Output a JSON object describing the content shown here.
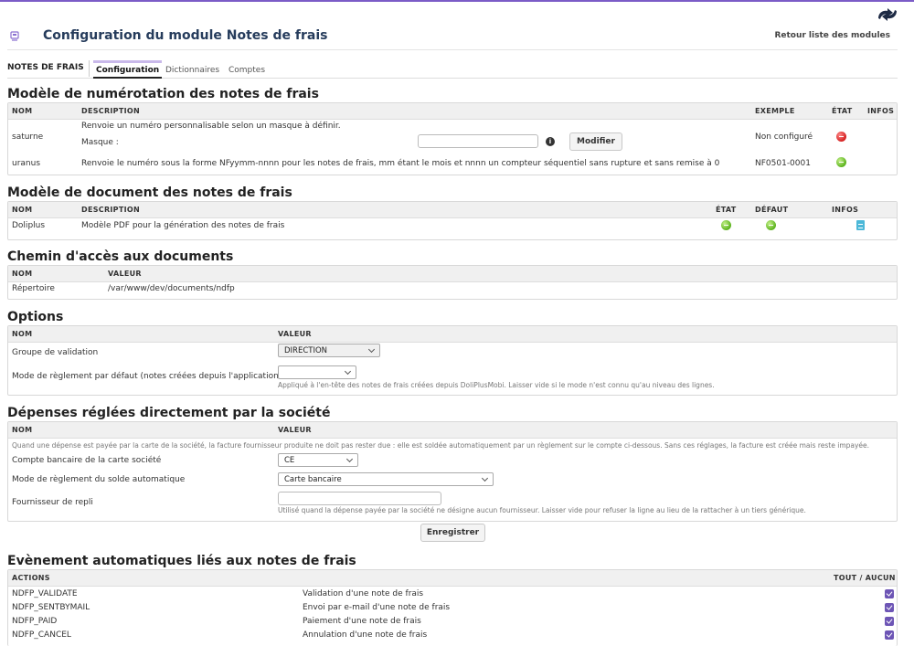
{
  "header": {
    "title": "Configuration du module Notes de frais",
    "back_link": "Retour liste des modules"
  },
  "tabs": {
    "module": "NOTES DE FRAIS",
    "items": [
      {
        "label": "Configuration"
      },
      {
        "label": "Dictionnaires"
      },
      {
        "label": "Comptes"
      }
    ]
  },
  "numbering": {
    "title": "Modèle de numérotation des notes de frais",
    "columns": {
      "name": "NOM",
      "description": "DESCRIPTION",
      "example": "EXEMPLE",
      "state": "ÉTAT",
      "infos": "INFOS"
    },
    "rows": [
      {
        "name": "saturne",
        "description": "Renvoie un numéro personnalisable selon un masque à définir.",
        "mask_label": "Masque :",
        "mask_value": "",
        "modify_label": "Modifier",
        "example": "Non configuré",
        "state": "disabled"
      },
      {
        "name": "uranus",
        "description": "Renvoie le numéro sous la forme NFyymm-nnnn pour les notes de frais, mm étant le mois et nnnn un compteur séquentiel sans rupture et sans remise à 0",
        "example": "NF0501-0001",
        "state": "enabled"
      }
    ]
  },
  "documents": {
    "title": "Modèle de document des notes de frais",
    "columns": {
      "name": "NOM",
      "description": "DESCRIPTION",
      "state": "ÉTAT",
      "default": "DÉFAUT",
      "infos": "INFOS"
    },
    "rows": [
      {
        "name": "Doliplus",
        "description": "Modèle PDF pour la génération des notes de frais",
        "state": "enabled",
        "default": "enabled",
        "info_icon": "document-icon"
      }
    ]
  },
  "path": {
    "title": "Chemin d'accès aux documents",
    "columns": {
      "name": "NOM",
      "value": "VALEUR"
    },
    "rows": [
      {
        "name": "Répertoire",
        "value": "/var/www/dev/documents/ndfp"
      }
    ]
  },
  "options": {
    "title": "Options",
    "columns": {
      "name": "NOM",
      "value": "VALEUR"
    },
    "validation_group_label": "Groupe de validation",
    "validation_group_value": "DIRECTION",
    "payment_mode_label": "Mode de règlement par défaut (notes créées depuis l'application)",
    "payment_mode_value": "",
    "payment_mode_note": "Appliqué à l'en-tête des notes de frais créées depuis DoliPlusMobi. Laisser vide si le mode n'est connu qu'au niveau des lignes."
  },
  "company_expenses": {
    "title": "Dépenses réglées directement par la société",
    "columns": {
      "name": "NOM",
      "value": "VALEUR"
    },
    "intro": "Quand une dépense est payée par la carte de la société, la facture fournisseur produite ne doit pas rester due : elle est soldée automatiquement par un règlement sur le compte ci-dessous. Sans ces réglages, la facture est créée mais reste impayée.",
    "bank_account_label": "Compte bancaire de la carte société",
    "bank_account_value": "CE",
    "auto_payment_label": "Mode de règlement du solde automatique",
    "auto_payment_value": "Carte bancaire",
    "fallback_supplier_label": "Fournisseur de repli",
    "fallback_supplier_value": "",
    "fallback_supplier_note": "Utilisé quand la dépense payée par la société ne désigne aucun fournisseur. Laisser vide pour refuser la ligne au lieu de la rattacher à un tiers générique."
  },
  "save_label": "Enregistrer",
  "events": {
    "title": "Evènement automatiques liés aux notes de frais",
    "columns": {
      "actions": "ACTIONS",
      "all_none": "TOUT / AUCUN"
    },
    "rows": [
      {
        "code": "NDFP_VALIDATE",
        "label": "Validation d'une note de frais",
        "checked": true
      },
      {
        "code": "NDFP_SENTBYMAIL",
        "label": "Envoi par e-mail d'une note de frais",
        "checked": true
      },
      {
        "code": "NDFP_PAID",
        "label": "Paiement d'une note de frais",
        "checked": true
      },
      {
        "code": "NDFP_CANCEL",
        "label": "Annulation d'une note de frais",
        "checked": true
      }
    ]
  },
  "colors": {
    "accent": "#7b5cc7",
    "title": "#263c5c",
    "enabled": "#5cb31e",
    "disabled": "#d41f1f",
    "checkbox": "#6d55b5"
  }
}
